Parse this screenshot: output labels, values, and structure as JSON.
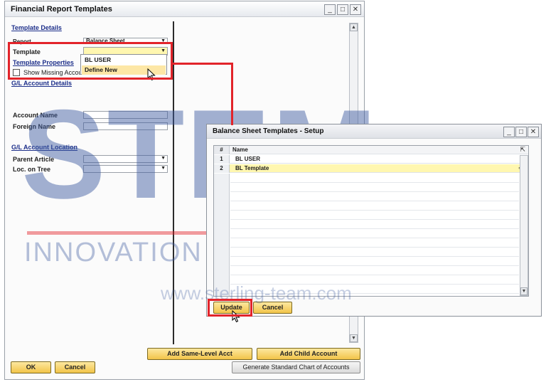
{
  "main_window": {
    "title": "Financial Report Templates",
    "controls": {
      "minimize": "_",
      "maximize": "□",
      "close": "✕"
    },
    "template_details_label": "Template Details",
    "report_label": "Report",
    "report_value": "Balance Sheet",
    "template_label": "Template",
    "template_properties_label": "Template Properties",
    "show_missing_label": "Show Missing Accou",
    "gl_account_details_label": "G/L Account Details",
    "account_name_label": "Account Name",
    "foreign_name_label": "Foreign Name",
    "gl_account_location_label": "G/L Account Location",
    "parent_article_label": "Parent Article",
    "loc_on_tree_label": "Loc. on Tree",
    "template_options": [
      "BL USER",
      "Define New"
    ],
    "add_same_level_label": "Add Same-Level Acct",
    "add_child_label": "Add Child Account",
    "ok_label": "OK",
    "cancel_label": "Cancel",
    "generate_label": "Generate Standard Chart of Accounts"
  },
  "setup_dialog": {
    "title": "Balance Sheet Templates - Setup",
    "controls": {
      "minimize": "_",
      "maximize": "□",
      "close": "✕"
    },
    "columns": {
      "num": "#",
      "name": "Name"
    },
    "rows": [
      {
        "num": "1",
        "name": "BL USER"
      },
      {
        "num": "2",
        "name": "BL Template"
      }
    ],
    "update_label": "Update",
    "cancel_label": "Cancel"
  },
  "watermark": {
    "big": "STEM",
    "registered": "®",
    "tagline": "INNOVATION • DESIGN • VALUE",
    "url": "www.sterling-team.com"
  },
  "colors": {
    "highlight": "#e2242a",
    "watermark_blue": "#3f5ca0",
    "button_gold": "#f2c449",
    "selected_yellow": "#fff7b0"
  }
}
